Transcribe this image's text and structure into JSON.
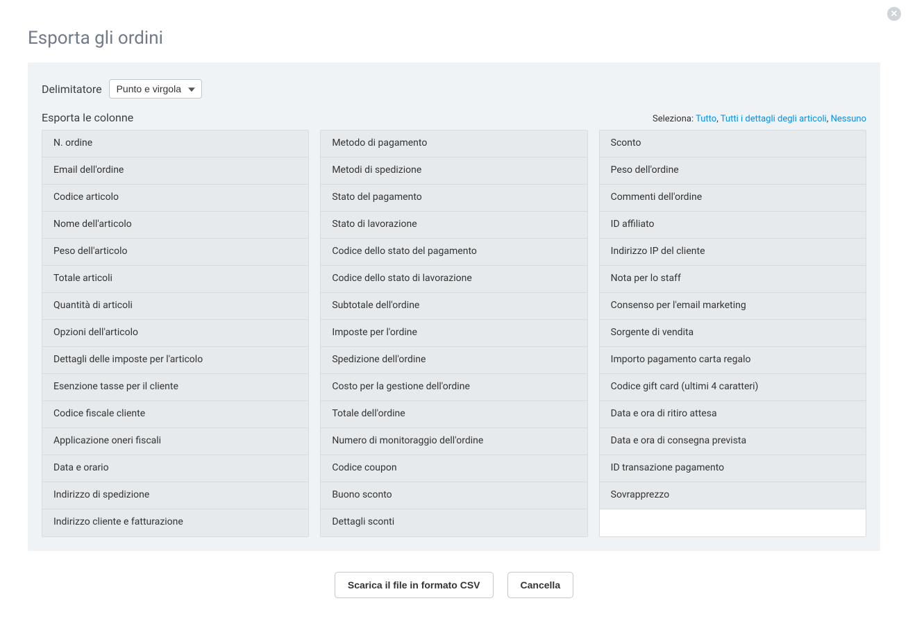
{
  "title": "Esporta gli ordini",
  "delimiter": {
    "label": "Delimitatore",
    "selected": "Punto e virgola"
  },
  "columns_section": {
    "label": "Esporta le colonne",
    "select_label": "Seleziona:",
    "link_all": "Tutto",
    "link_details": "Tutti i dettagli degli articoli",
    "link_none": "Nessuno"
  },
  "columns": {
    "col1": [
      "N. ordine",
      "Email dell'ordine",
      "Codice articolo",
      "Nome dell'articolo",
      "Peso dell'articolo",
      "Totale articoli",
      "Quantità di articoli",
      "Opzioni dell'articolo",
      "Dettagli delle imposte per l'articolo",
      "Esenzione tasse per il cliente",
      "Codice fiscale cliente",
      "Applicazione oneri fiscali",
      "Data e orario",
      "Indirizzo di spedizione",
      "Indirizzo cliente e fatturazione"
    ],
    "col2": [
      "Metodo di pagamento",
      "Metodi di spedizione",
      "Stato del pagamento",
      "Stato di lavorazione",
      "Codice dello stato del pagamento",
      "Codice dello stato di lavorazione",
      "Subtotale dell'ordine",
      "Imposte per l'ordine",
      "Spedizione dell'ordine",
      "Costo per la gestione dell'ordine",
      "Totale dell'ordine",
      "Numero di monitoraggio dell'ordine",
      "Codice coupon",
      "Buono sconto",
      "Dettagli sconti"
    ],
    "col3": [
      "Sconto",
      "Peso dell'ordine",
      "Commenti dell'ordine",
      "ID affiliato",
      "Indirizzo IP del cliente",
      "Nota per lo staff",
      "Consenso per l'email marketing",
      "Sorgente di vendita",
      "Importo pagamento carta regalo",
      "Codice gift card (ultimi 4 caratteri)",
      "Data e ora di ritiro attesa",
      "Data e ora di consegna prevista",
      "ID transazione pagamento",
      "Sovrapprezzo"
    ]
  },
  "buttons": {
    "download": "Scarica il file in formato CSV",
    "cancel": "Cancella"
  }
}
